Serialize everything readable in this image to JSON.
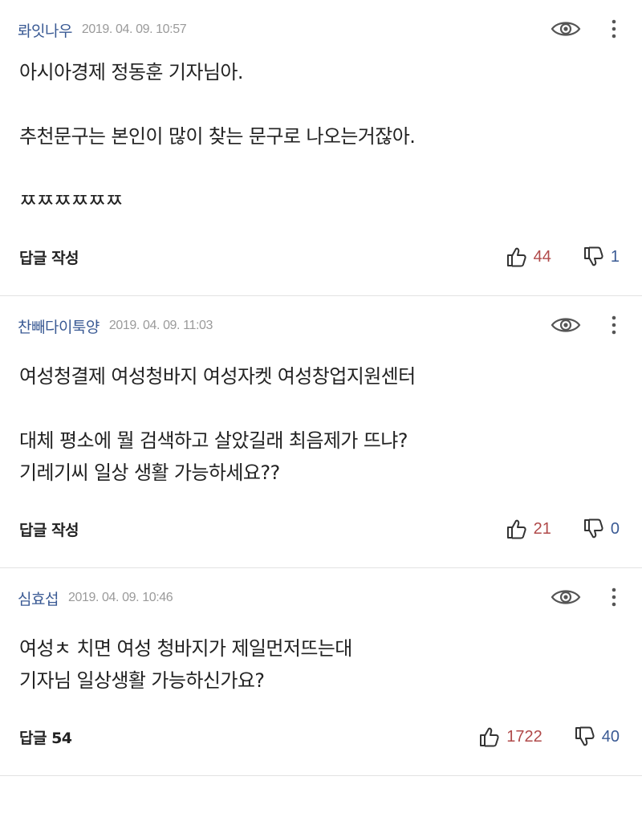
{
  "comments": [
    {
      "author": "롸잇나우",
      "date": "2019. 04. 09. 10:57",
      "lines": [
        "아시아경제 정동훈 기자님아.",
        "추천문구는 본인이 많이 찾는 문구로 나오는거잖아.",
        "ㅉㅉㅉㅉㅉㅉ"
      ],
      "reply_label": "답글 작성",
      "likes": "44",
      "dislikes": "1"
    },
    {
      "author": "찬빼다이툭양",
      "date": "2019. 04. 09. 11:03",
      "lines": [
        "여성청결제 여성청바지 여성자켓 여성창업지원센터",
        "대체 평소에 뭘 검색하고 살았길래 최음제가 뜨냐?",
        "기레기씨 일상 생활 가능하세요??"
      ],
      "reply_label": "답글 작성",
      "likes": "21",
      "dislikes": "0"
    },
    {
      "author": "심효섭",
      "date": "2019. 04. 09. 10:46",
      "lines": [
        "여성ㅊ 치면 여성  청바지가 제일먼저뜨는대",
        "기자님 일상생활 가능하신가요?"
      ],
      "reply_label": "답글 54",
      "likes": "1722",
      "dislikes": "40"
    }
  ],
  "icons": {
    "view": "eye-icon",
    "more": "more-vertical-icon",
    "like": "thumbs-up-icon",
    "dislike": "thumbs-down-icon"
  },
  "colors": {
    "author": "#3a5a94",
    "like": "#b04a4a",
    "dislike": "#3a5a94",
    "date": "#9a9a9a"
  }
}
